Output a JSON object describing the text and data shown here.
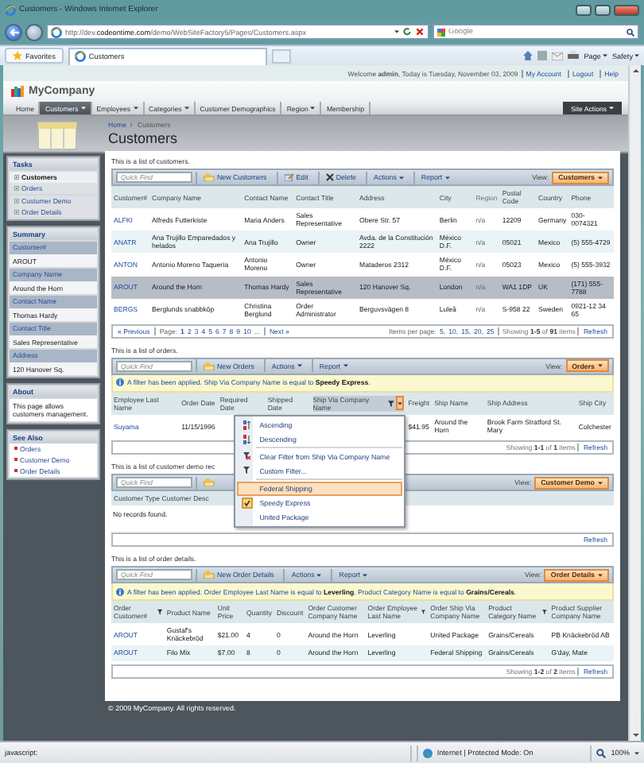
{
  "window": {
    "title": "Customers - Windows Internet Explorer"
  },
  "address_bar": {
    "url": "http://dev.**codeontime.com**/demo/WebSiteFactory5/Pages/Customers.aspx"
  },
  "search": {
    "placeholder": "Google"
  },
  "favorites_bar": {
    "favorites": "Favorites",
    "tab": "Customers",
    "commands": [
      "Page",
      "Safety"
    ]
  },
  "welcome": {
    "text": "Welcome **admin**, Today is Tuesday, November 03, 2009",
    "links": [
      "My Account",
      "Logout",
      "Help"
    ]
  },
  "logo": "MyCompany",
  "menu": {
    "items": [
      {
        "label": "Home",
        "selected": false,
        "dropdown": false
      },
      {
        "label": "Customers",
        "selected": true,
        "dropdown": true
      },
      {
        "label": "Employees",
        "selected": false,
        "dropdown": true
      },
      {
        "label": "Categories",
        "selected": false,
        "dropdown": true
      },
      {
        "label": "Customer Demographics",
        "selected": false,
        "dropdown": false
      },
      {
        "label": "Region",
        "selected": false,
        "dropdown": true
      },
      {
        "label": "Membership",
        "selected": false,
        "dropdown": false
      }
    ],
    "site_actions": "Site Actions"
  },
  "breadcrumb": [
    "Home",
    "Customers"
  ],
  "page_title": "Customers",
  "sidebar": {
    "tasks": {
      "title": "Tasks",
      "items": [
        {
          "label": "Customers",
          "selected": true
        },
        {
          "label": "Orders",
          "selected": false
        },
        {
          "label": "Customer Demo",
          "selected": false
        },
        {
          "label": "Order Details",
          "selected": false
        }
      ]
    },
    "summary": {
      "title": "Summary",
      "fields": [
        {
          "label": "Customer#",
          "value": "AROUT"
        },
        {
          "label": "Company Name",
          "value": "Around the Horn"
        },
        {
          "label": "Contact Name",
          "value": "Thomas Hardy"
        },
        {
          "label": "Contact Title",
          "value": "Sales Representative"
        },
        {
          "label": "Address",
          "value": "120 Hanover Sq."
        }
      ]
    },
    "about": {
      "title": "About",
      "text": "This page allows customers management."
    },
    "see_also": {
      "title": "See Also",
      "items": [
        "Orders",
        "Customer Demo",
        "Order Details"
      ]
    }
  },
  "views": [
    {
      "description": "This is a list of customers.",
      "toolbar": {
        "placeholder": "Quick Find",
        "buttons": [
          {
            "kind": "new",
            "label": "New Customers"
          },
          {
            "kind": "edit",
            "label": "Edit"
          },
          {
            "kind": "delete",
            "label": "Delete"
          },
          {
            "kind": "menu",
            "label": "Actions"
          },
          {
            "kind": "menu",
            "label": "Report"
          }
        ],
        "view_label": "View:",
        "view": "Customers"
      },
      "columns": [
        {
          "label": "Customer#",
          "kind": "link",
          "filtered": false,
          "menu_open": false
        },
        {
          "label": "Company Name",
          "kind": "text",
          "filtered": false,
          "menu_open": false
        },
        {
          "label": "Contact Name",
          "kind": "text",
          "filtered": false,
          "menu_open": false
        },
        {
          "label": "Contact Title",
          "kind": "text",
          "filtered": false,
          "menu_open": false
        },
        {
          "label": "Address",
          "kind": "text",
          "filtered": false,
          "menu_open": false
        },
        {
          "label": "City",
          "kind": "text",
          "filtered": false,
          "menu_open": false
        },
        {
          "label": "Region",
          "kind": "muted",
          "filtered": false,
          "menu_open": false
        },
        {
          "label": "Postal Code",
          "kind": "text",
          "filtered": false,
          "menu_open": false
        },
        {
          "label": "Country",
          "kind": "text",
          "filtered": false,
          "menu_open": false
        },
        {
          "label": "Phone",
          "kind": "text",
          "filtered": false,
          "menu_open": false
        }
      ],
      "rows": [
        {
          "selected": false,
          "cells": [
            "ALFKI",
            "Alfreds Futterkiste",
            "Maria Anders",
            "Sales Representative",
            "Obere Str. 57",
            "Berlin",
            "n/a",
            "12209",
            "Germany",
            "030-0074321"
          ]
        },
        {
          "selected": false,
          "cells": [
            "ANATR",
            "Ana Trujillo Emparedados y helados",
            "Ana Trujillo",
            "Owner",
            "Avda. de la Constitución 2222",
            "México D.F.",
            "n/a",
            "05021",
            "Mexico",
            "(5) 555-4729"
          ]
        },
        {
          "selected": false,
          "cells": [
            "ANTON",
            "Antonio Moreno Taquería",
            "Antonio Moreno",
            "Owner",
            "Mataderos 2312",
            "México D.F.",
            "n/a",
            "05023",
            "Mexico",
            "(5) 555-3932"
          ]
        },
        {
          "selected": true,
          "cells": [
            "AROUT",
            "Around the Horn",
            "Thomas Hardy",
            "Sales Representative",
            "120 Hanover Sq.",
            "London",
            "n/a",
            "WA1 1DP",
            "UK",
            "(171) 555-7788"
          ]
        },
        {
          "selected": false,
          "cells": [
            "BERGS",
            "Berglunds snabbköp",
            "Christina Berglund",
            "Order Administrator",
            "Berguvsvägen 8",
            "Luleå",
            "n/a",
            "S-958 22",
            "Sweden",
            "0921-12 34 65"
          ]
        }
      ],
      "footer": {
        "pager": {
          "previous": "« Previous",
          "page_label": "Page:",
          "pages": [
            {
              "label": "1",
              "selected": true
            },
            {
              "label": "2",
              "selected": false
            },
            {
              "label": "3",
              "selected": false
            },
            {
              "label": "4",
              "selected": false
            },
            {
              "label": "5",
              "selected": false
            },
            {
              "label": "6",
              "selected": false
            },
            {
              "label": "7",
              "selected": false
            },
            {
              "label": "8",
              "selected": false
            },
            {
              "label": "9",
              "selected": false
            },
            {
              "label": "10",
              "selected": false
            }
          ],
          "ellipsis": "...",
          "next": "Next »",
          "items_per_page": "Items per page:",
          "sizes": [
            "5,",
            "10,",
            "15,",
            "20,",
            "25"
          ]
        },
        "showing": "Showing **1-5** of **91** items",
        "refresh": "Refresh"
      }
    },
    {
      "description": "This is a list of orders.",
      "toolbar": {
        "placeholder": "Quick Find",
        "buttons": [
          {
            "kind": "new",
            "label": "New Orders"
          },
          {
            "kind": "menu",
            "label": "Actions"
          },
          {
            "kind": "menu",
            "label": "Report"
          }
        ],
        "view_label": "View:",
        "view": "Orders"
      },
      "filter": "A filter has been applied. Ship Via Company Name is equal to **Speedy Express**.",
      "columns": [
        {
          "label": "Employee Last Name",
          "kind": "link",
          "filtered": false,
          "menu_open": false
        },
        {
          "label": "Order Date",
          "kind": "text",
          "filtered": false,
          "menu_open": false
        },
        {
          "label": "Required Date",
          "kind": "text",
          "filtered": false,
          "menu_open": false
        },
        {
          "label": "Shipped Date",
          "kind": "text",
          "filtered": false,
          "menu_open": false
        },
        {
          "label": "Ship Via Company Name",
          "kind": "text",
          "filtered": true,
          "menu_open": true
        },
        {
          "label": "Freight",
          "kind": "text",
          "filtered": false,
          "menu_open": false
        },
        {
          "label": "Ship Name",
          "kind": "text",
          "filtered": false,
          "menu_open": false
        },
        {
          "label": "Ship Address",
          "kind": "text",
          "filtered": false,
          "menu_open": false
        },
        {
          "label": "Ship City",
          "kind": "text",
          "filtered": false,
          "menu_open": false
        }
      ],
      "rows": [
        {
          "selected": false,
          "cells": [
            "Suyama",
            "11/15/1996",
            null,
            null,
            null,
            "$41.95",
            "Around the Horn",
            "Brook Farm Stratford St. Mary",
            "Colchester"
          ]
        }
      ],
      "footer": {
        "showing": "Showing **1-1** of **1** items",
        "refresh": "Refresh"
      }
    },
    {
      "description": "This is a list of customer demo rec",
      "toolbar": {
        "placeholder": "Quick Find",
        "buttons": [
          {
            "kind": "new"
          }
        ],
        "view_label": "View:",
        "view": "Customer Demo"
      },
      "columns": [
        {
          "label": "Customer Type Customer Desc",
          "kind": "text",
          "filtered": false,
          "menu_open": false
        }
      ],
      "empty": "No records found.",
      "footer": {
        "refresh": "Refresh"
      }
    },
    {
      "description": "This is a list of order details.",
      "toolbar": {
        "placeholder": "Quick Find",
        "buttons": [
          {
            "kind": "new",
            "label": "New Order Details"
          },
          {
            "kind": "menu",
            "label": "Actions"
          },
          {
            "kind": "menu",
            "label": "Report"
          }
        ],
        "view_label": "View:",
        "view": "Order Details"
      },
      "filter": "A filter has been applied. Order Employee Last Name is equal to **Leverling**. Product Category Name is equal to **Grains/Cereals**.",
      "columns": [
        {
          "label": "Order Customer#",
          "kind": "link",
          "filtered": true,
          "menu_open": false
        },
        {
          "label": "Product Name",
          "kind": "text",
          "filtered": false,
          "menu_open": false
        },
        {
          "label": "Unit Price",
          "kind": "text",
          "filtered": false,
          "menu_open": false
        },
        {
          "label": "Quantity",
          "kind": "text",
          "filtered": false,
          "menu_open": false
        },
        {
          "label": "Discount",
          "kind": "text",
          "filtered": false,
          "menu_open": false
        },
        {
          "label": "Order Customer Company Name",
          "kind": "text",
          "filtered": false,
          "menu_open": false
        },
        {
          "label": "Order Employee Last Name",
          "kind": "text",
          "filtered": true,
          "menu_open": false
        },
        {
          "label": "Order Ship Via Company Name",
          "kind": "text",
          "filtered": false,
          "menu_open": false
        },
        {
          "label": "Product Category Name",
          "kind": "text",
          "filtered": true,
          "menu_open": false
        },
        {
          "label": "Product Supplier Company Name",
          "kind": "text",
          "filtered": false,
          "menu_open": false
        }
      ],
      "rows": [
        {
          "selected": false,
          "cells": [
            "AROUT",
            "Gustaf's Knäckebröd",
            "$21.00",
            "4",
            "0",
            "Around the Horn",
            "Leverling",
            "United Package",
            "Grains/Cereals",
            "PB Knäckebröd AB"
          ]
        },
        {
          "selected": false,
          "cells": [
            "AROUT",
            "Filo Mix",
            "$7.00",
            "8",
            "0",
            "Around the Horn",
            "Leverling",
            "Federal Shipping",
            "Grains/Cereals",
            "G'day, Mate"
          ]
        }
      ],
      "footer": {
        "showing": "Showing **1-2** of **2** items",
        "refresh": "Refresh"
      }
    }
  ],
  "column_menu": {
    "items": [
      {
        "label": "Ascending",
        "kind": "sort-asc",
        "checked": false,
        "highlighted": false
      },
      {
        "label": "Descending",
        "kind": "sort-desc",
        "checked": false,
        "highlighted": false
      },
      {
        "label": "Clear Filter from Ship Via Company Name",
        "kind": "clear-filter",
        "checked": false,
        "highlighted": false
      },
      {
        "label": "Custom Filter...",
        "kind": "custom-filter",
        "checked": false,
        "highlighted": false
      },
      {
        "label": "Federal Shipping",
        "kind": "value",
        "checked": false,
        "highlighted": true
      },
      {
        "label": "Speedy Express",
        "kind": "value",
        "checked": true,
        "highlighted": false
      },
      {
        "label": "United Package",
        "kind": "value",
        "checked": false,
        "highlighted": false
      }
    ]
  },
  "footer": "© 2009 MyCompany. All rights reserved.",
  "status_bar": {
    "left": "javascript:",
    "zone": "Internet | Protected Mode: On",
    "zoom": "100%"
  }
}
